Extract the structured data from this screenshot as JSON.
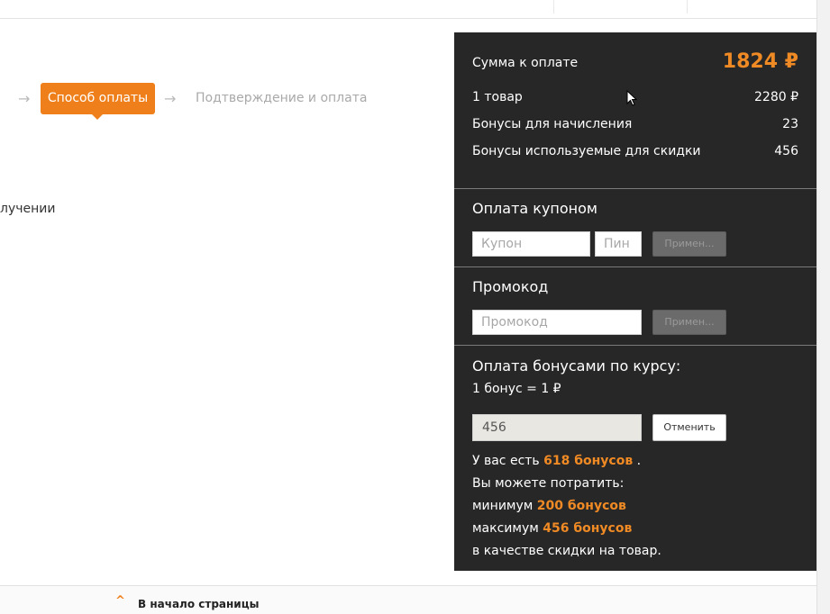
{
  "steps": {
    "arrow_symbol": "→",
    "active_label": "Способ оплаты",
    "next_label": "Подтверждение и оплата"
  },
  "cut_text": "лучении",
  "summary": {
    "total_label": "Сумма к оплате",
    "total_value": "1824 ₽",
    "rows": [
      {
        "label": "1 товар",
        "value": "2280 ₽"
      },
      {
        "label": "Бонусы для начисления",
        "value": "23"
      },
      {
        "label": "Бонусы используемые для скидки",
        "value": "456"
      }
    ]
  },
  "coupon": {
    "title": "Оплата купоном",
    "coupon_placeholder": "Купон",
    "pin_placeholder": "Пин",
    "apply_label": "Примен..."
  },
  "promo": {
    "title": "Промокод",
    "placeholder": "Промокод",
    "apply_label": "Примен..."
  },
  "bonus": {
    "title": "Оплата бонусами по курсу:",
    "rate": "1 бонус = 1  ₽",
    "value": "456",
    "cancel_label": "Отменить",
    "have_prefix": "У вас есть ",
    "have_amount": "618 бонусов",
    "have_suffix": " .",
    "can_spend": "Вы можете потратить:",
    "min_prefix": "минимум ",
    "min_amount": "200 бонусов",
    "max_prefix": "максимум ",
    "max_amount": "456 бонусов",
    "tail": "в качестве скидки на товар."
  },
  "footer": {
    "up_icon": "^",
    "label": "В начало страницы"
  },
  "colors": {
    "accent": "#ef7f1a",
    "panel_bg": "#272727"
  }
}
